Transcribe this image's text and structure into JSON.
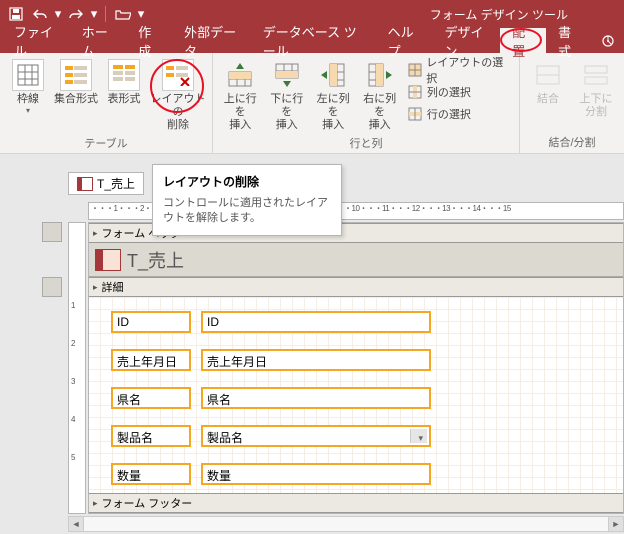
{
  "titlebar": {
    "context_title": "フォーム デザイン ツール"
  },
  "tabs": {
    "file": "ファイル",
    "home": "ホーム",
    "create": "作成",
    "external": "外部データ",
    "dbtools": "データベース ツール",
    "help": "ヘルプ",
    "design": "デザイン",
    "arrange": "配置",
    "format": "書式"
  },
  "ribbon": {
    "gridlines": "枠線",
    "stacked": "集合形式",
    "tabular": "表形式",
    "remove_layout": "レイアウトの\n削除",
    "insert_above": "上に行を\n挿入",
    "insert_below": "下に行を\n挿入",
    "insert_left": "左に列を\n挿入",
    "insert_right": "右に列を\n挿入",
    "select_layout": "レイアウトの選択",
    "select_column": "列の選択",
    "select_row": "行の選択",
    "merge": "結合",
    "split_v": "上下に\n分割",
    "group_table": "テーブル",
    "group_rowscols": "行と列",
    "group_merge": "結合/分割"
  },
  "tooltip": {
    "title": "レイアウトの削除",
    "body": "コントロールに適用されたレイアウトを解除します。"
  },
  "doc": {
    "tab_name": "T_売上",
    "section_header": "フォーム ヘッダー",
    "section_detail": "詳細",
    "section_footer": "フォーム フッター",
    "form_title": "T_売上",
    "ruler_h": "・・・1・・・2・・・3・・・4・・・5・・・6・・・7・・・8・・・9・・・10・・・11・・・12・・・13・・・14・・・15",
    "ruler_v": [
      "1",
      "2",
      "3",
      "4",
      "5"
    ],
    "fields": [
      {
        "label": "ID",
        "control": "ID",
        "type": "text"
      },
      {
        "label": "売上年月日",
        "control": "売上年月日",
        "type": "text"
      },
      {
        "label": "県名",
        "control": "県名",
        "type": "text"
      },
      {
        "label": "製品名",
        "control": "製品名",
        "type": "combo"
      },
      {
        "label": "数量",
        "control": "数量",
        "type": "text"
      }
    ]
  }
}
